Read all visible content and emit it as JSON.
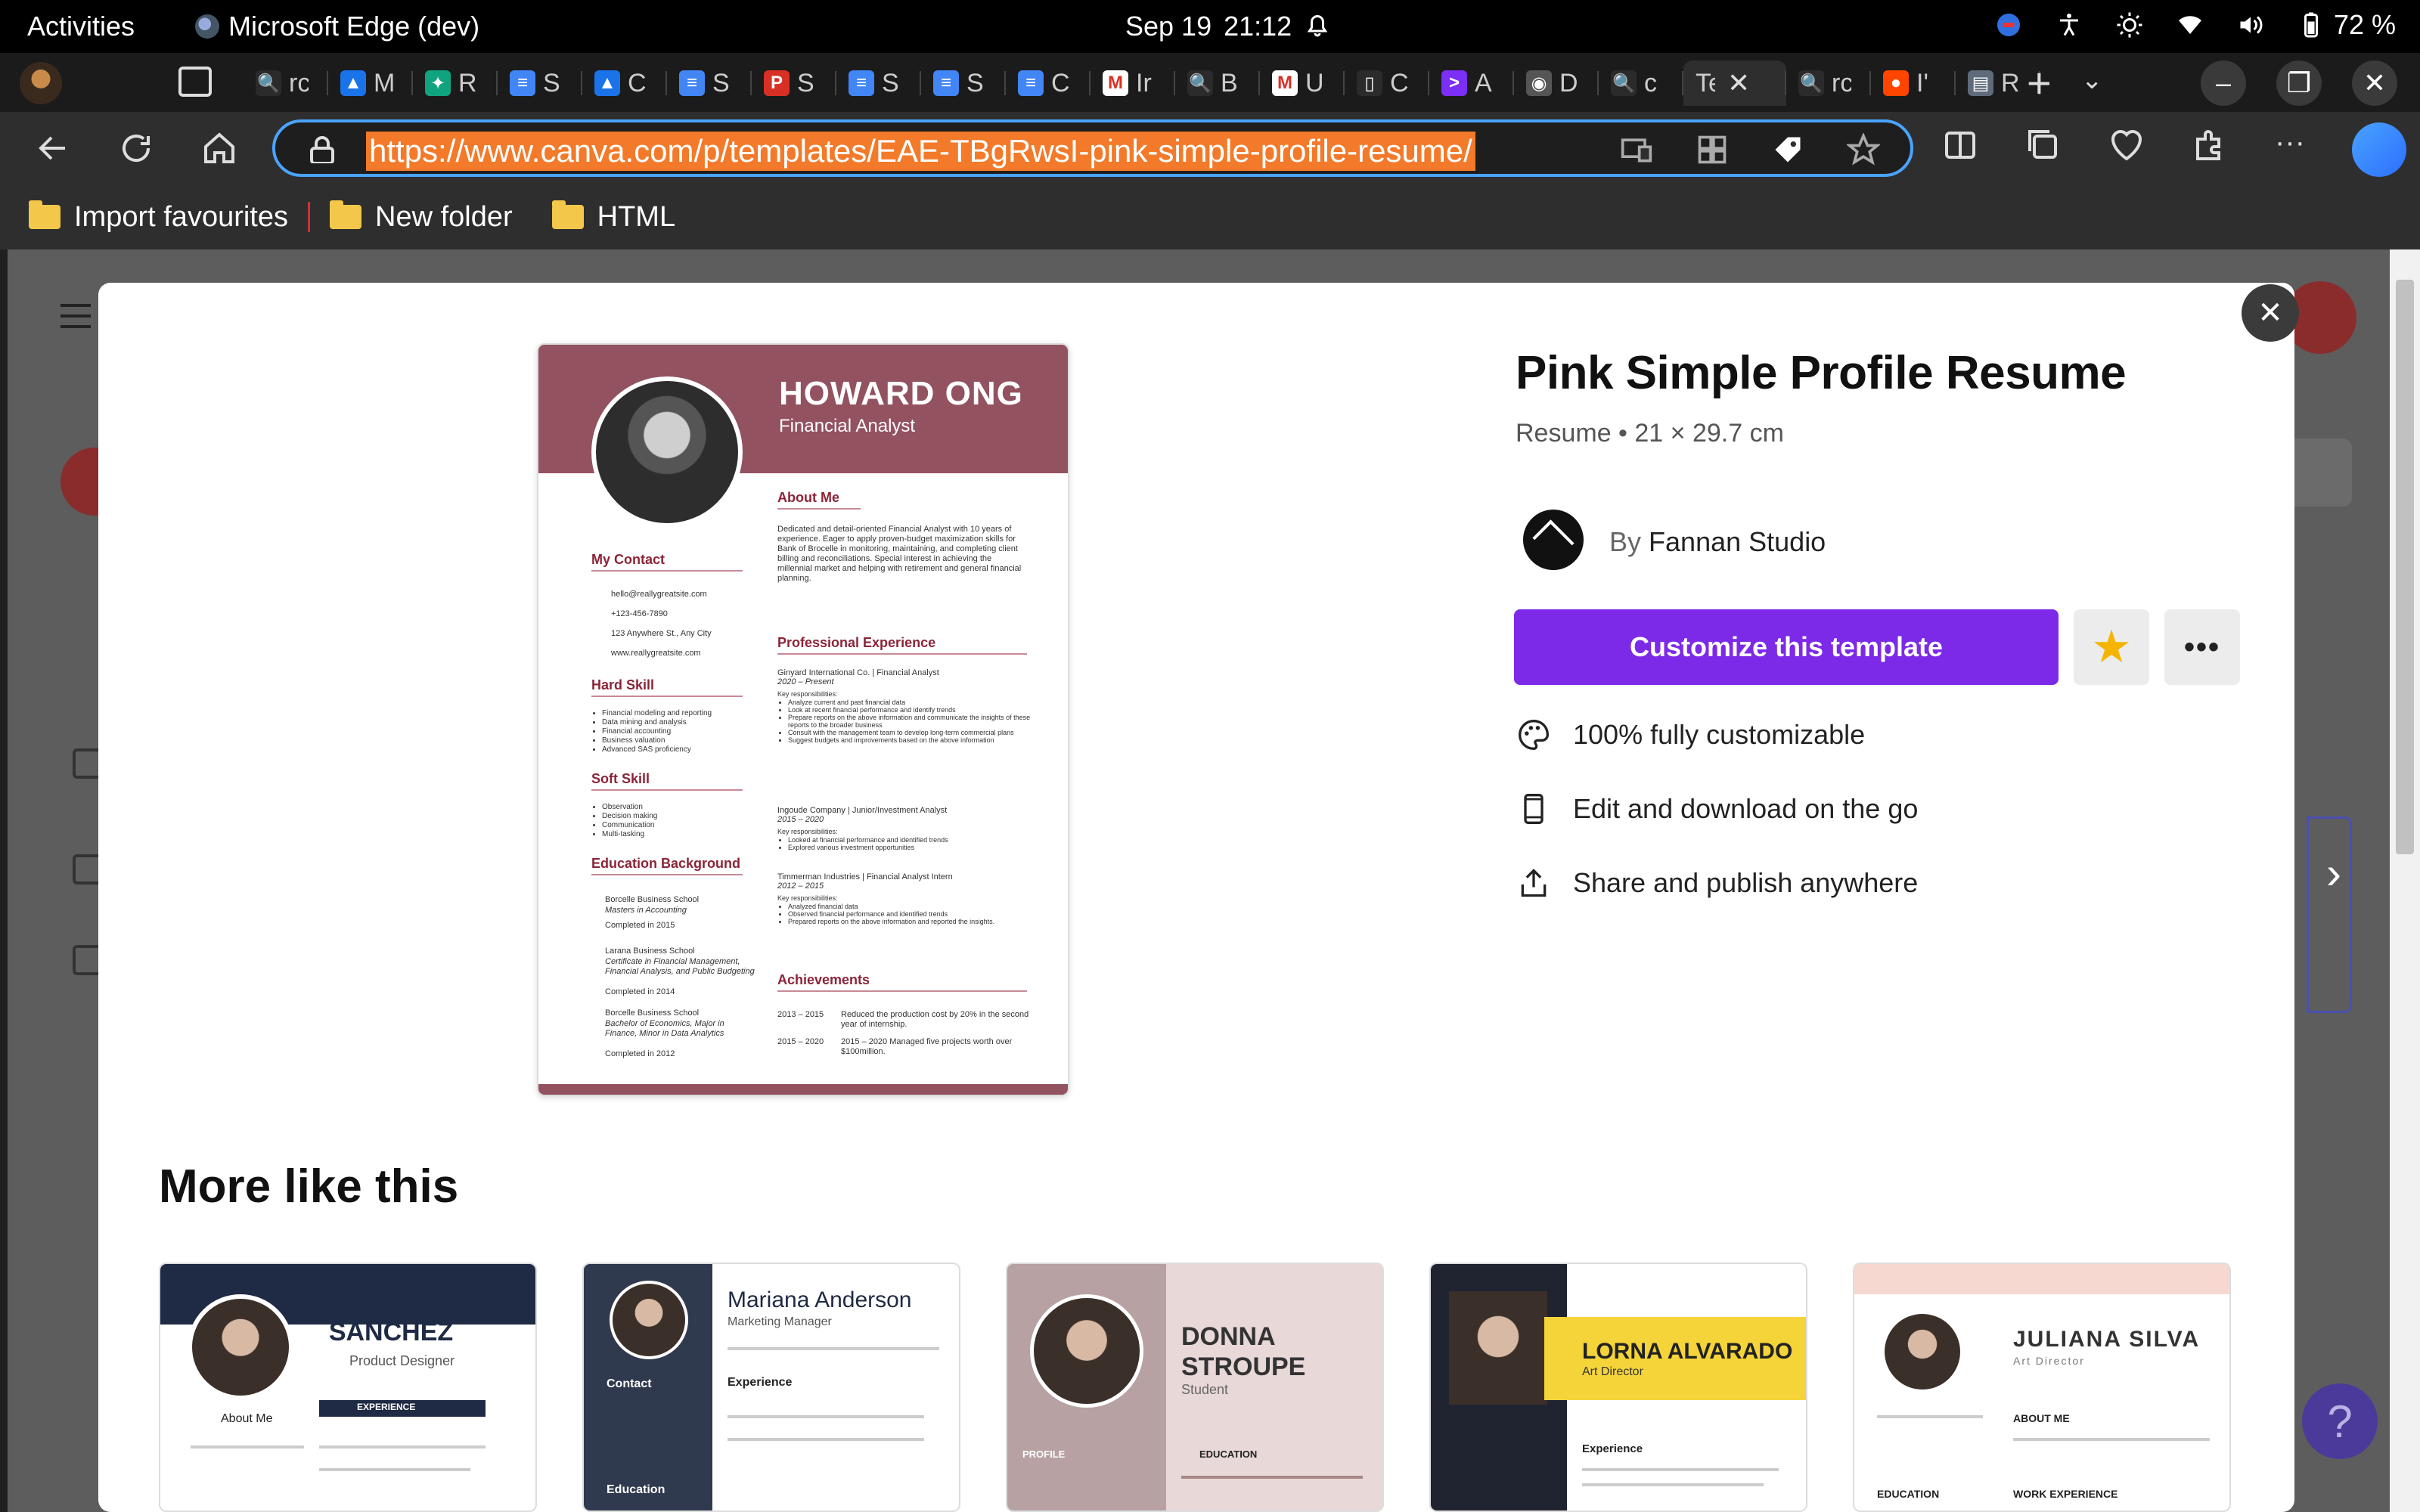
{
  "system_bar": {
    "activities": "Activities",
    "app_name": "Microsoft Edge (dev)",
    "date": "Sep 19",
    "time": "21:12",
    "battery": "72 %"
  },
  "tabs": [
    {
      "label": "rc",
      "fav_color": "#2b2b2b",
      "fav_glyph": "🔍"
    },
    {
      "label": "M",
      "fav_color": "#1a73e8",
      "fav_glyph": "▲"
    },
    {
      "label": "R",
      "fav_color": "#10a37f",
      "fav_glyph": "✦"
    },
    {
      "label": "S",
      "fav_color": "#4285f4",
      "fav_glyph": "≡"
    },
    {
      "label": "C",
      "fav_color": "#1a73e8",
      "fav_glyph": "▲"
    },
    {
      "label": "S",
      "fav_color": "#4285f4",
      "fav_glyph": "≡"
    },
    {
      "label": "S",
      "fav_color": "#d93025",
      "fav_glyph": "P"
    },
    {
      "label": "S",
      "fav_color": "#4285f4",
      "fav_glyph": "≡"
    },
    {
      "label": "S",
      "fav_color": "#4285f4",
      "fav_glyph": "≡"
    },
    {
      "label": "C",
      "fav_color": "#4285f4",
      "fav_glyph": "≡"
    },
    {
      "label": "Ir",
      "fav_color": "#ffffff",
      "fav_glyph": "M"
    },
    {
      "label": "B",
      "fav_color": "#2b2b2b",
      "fav_glyph": "🔍"
    },
    {
      "label": "U",
      "fav_color": "#ffffff",
      "fav_glyph": "M"
    },
    {
      "label": "C",
      "fav_color": "#2b2b2b",
      "fav_glyph": "▯"
    },
    {
      "label": "A",
      "fav_color": "#7b2ff7",
      "fav_glyph": ">"
    },
    {
      "label": "D",
      "fav_color": "#555555",
      "fav_glyph": "◉"
    },
    {
      "label": "c",
      "fav_color": "#2b2b2b",
      "fav_glyph": "🔍"
    },
    {
      "label": "Te",
      "fav_color": "",
      "fav_glyph": "",
      "active": true
    },
    {
      "label": "rc",
      "fav_color": "#2b2b2b",
      "fav_glyph": "🔍"
    },
    {
      "label": "I'",
      "fav_color": "#ff4500",
      "fav_glyph": "●"
    },
    {
      "label": "R",
      "fav_color": "#5f6b7a",
      "fav_glyph": "▤"
    }
  ],
  "tab_close_glyph": "✕",
  "new_tab_glyph": "+",
  "address_bar": {
    "url": "https://www.canva.com/p/templates/EAE-TBgRwsI-pink-simple-profile-resume/"
  },
  "bookmarks": [
    {
      "label": "Import favourites"
    },
    {
      "label": "New folder"
    },
    {
      "label": "HTML"
    }
  ],
  "modal": {
    "close_glyph": "✕",
    "next_glyph": "›",
    "template_title": "Pink Simple Profile Resume",
    "template_meta": "Resume • 21 × 29.7 cm",
    "by_prefix": "By",
    "author": "Fannan Studio",
    "cta_label": "Customize this template",
    "star_glyph": "★",
    "more_glyph": "•••",
    "features": [
      {
        "icon": "palette-icon",
        "label": "100% fully customizable"
      },
      {
        "icon": "phone-icon",
        "label": "Edit and download on the go"
      },
      {
        "icon": "share-icon",
        "label": "Share and publish anywhere"
      }
    ],
    "more_like_this": "More like this",
    "accent_color": "#7d2ae8"
  },
  "resume": {
    "name": "HOWARD ONG",
    "role": "Financial Analyst",
    "about_title": "About Me",
    "about_text": "Dedicated and detail-oriented Financial Analyst with 10 years of experience. Eager to apply proven-budget maximization skills for Bank of Brocelle in monitoring, maintaining, and completing client billing and reconciliations. Special interest in achieving the millennial market and helping with retirement and general financial planning.",
    "contact_title": "My Contact",
    "contact": [
      "hello@reallygreatsite.com",
      "+123-456-7890",
      "123 Anywhere St., Any City",
      "www.reallygreatsite.com"
    ],
    "hard_skill_title": "Hard Skill",
    "hard_skills": [
      "Financial modeling and reporting",
      "Data mining and analysis",
      "Financial accounting",
      "Business valuation",
      "Advanced SAS proficiency"
    ],
    "soft_skill_title": "Soft Skill",
    "soft_skills": [
      "Observation",
      "Decision making",
      "Communication",
      "Multi-tasking"
    ],
    "education_title": "Education Background",
    "education": [
      {
        "school": "Borcelle Business School",
        "degree": "Masters in Accounting",
        "done": "Completed in 2015"
      },
      {
        "school": "Larana Business School",
        "degree": "Certificate in Financial Management, Financial Analysis, and Public Budgeting",
        "done": "Completed in 2014"
      },
      {
        "school": "Borcelle Business School",
        "degree": "Bachelor of Economics, Major in Finance, Minor in Data Analytics",
        "done": "Completed in 2012"
      }
    ],
    "experience_title": "Professional Experience",
    "experience": [
      {
        "company": "Ginyard International Co. | Financial Analyst",
        "dates": "2020 – Present",
        "resp": "Key responsibilities:",
        "bullets": [
          "Analyze current and past financial data",
          "Look at recent financial performance and identify trends",
          "Prepare reports on the above information and communicate the insights of these reports to the broader business",
          "Consult with the management team to develop long-term commercial plans",
          "Suggest budgets and improvements based on the above information"
        ]
      },
      {
        "company": "Ingoude Company | Junior/Investment Analyst",
        "dates": "2015 – 2020",
        "resp": "Key responsibilities:",
        "bullets": [
          "Looked at financial performance and identified trends",
          "Explored various investment opportunities"
        ]
      },
      {
        "company": "Timmerman Industries | Financial Analyst Intern",
        "dates": "2012 – 2015",
        "resp": "Key responsibilities:",
        "bullets": [
          "Analyzed financial data",
          "Observed financial performance and identified trends",
          "Prepared reports on the above information and reported the insights."
        ]
      }
    ],
    "achievements_title": "Achievements",
    "achievements": [
      {
        "years": "2013 – 2015",
        "text": "Reduced the production cost by 20% in the second year of internship."
      },
      {
        "years": "2015 – 2020",
        "text": "2015 – 2020 Managed five projects worth over $100million."
      }
    ]
  },
  "similar_templates": [
    {
      "name": "RICHARD SANCHEZ",
      "sub": "Product Designer",
      "labels": [
        "About Me",
        "EXPERIENCE"
      ],
      "accent": "#1f2a44"
    },
    {
      "name": "Mariana Anderson",
      "sub": "Marketing Manager",
      "labels": [
        "Contact",
        "Experience",
        "Education"
      ],
      "accent": "#2f3a4f"
    },
    {
      "name": "DONNA STROUPE",
      "sub": "Student",
      "labels": [
        "PROFILE",
        "EDUCATION"
      ],
      "accent": "#b8a1a3"
    },
    {
      "name": "LORNA ALVARADO",
      "sub": "Art Director",
      "labels": [
        "Experience"
      ],
      "accent": "#f5d43a"
    },
    {
      "name": "JULIANA SILVA",
      "sub": "Art Director",
      "labels": [
        "ABOUT ME",
        "EDUCATION",
        "WORK EXPERIENCE"
      ],
      "accent": "#f7d8d0"
    }
  ]
}
